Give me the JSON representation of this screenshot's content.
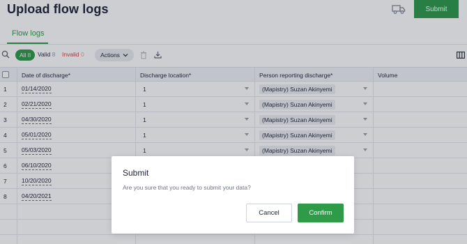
{
  "header": {
    "title": "Upload flow logs",
    "truck_icon": "truck-icon",
    "submit_label": "Submit"
  },
  "tabs": [
    {
      "label": "Flow logs",
      "active": true
    }
  ],
  "toolbar": {
    "search_icon": "search-icon",
    "filters": {
      "all": {
        "label": "All",
        "count": "8"
      },
      "valid": {
        "label": "Valid",
        "count": "8"
      },
      "invalid": {
        "label": "Invalid",
        "count": "0"
      }
    },
    "actions_label": "Actions",
    "icons": [
      "trash-icon",
      "download-icon",
      "columns-icon"
    ]
  },
  "table": {
    "columns": [
      "Date of discharge*",
      "Discharge location*",
      "Person reporting discharge*",
      "Volume"
    ],
    "rows": [
      {
        "num": "1",
        "date": "01/14/2020",
        "location": "1",
        "person": "(Mapistry) Suzan Akinyemi",
        "volume": ""
      },
      {
        "num": "2",
        "date": "02/21/2020",
        "location": "1",
        "person": "(Mapistry) Suzan Akinyemi",
        "volume": ""
      },
      {
        "num": "3",
        "date": "04/30/2020",
        "location": "1",
        "person": "(Mapistry) Suzan Akinyemi",
        "volume": ""
      },
      {
        "num": "4",
        "date": "05/01/2020",
        "location": "1",
        "person": "(Mapistry) Suzan Akinyemi",
        "volume": ""
      },
      {
        "num": "5",
        "date": "05/03/2020",
        "location": "1",
        "person": "(Mapistry) Suzan Akinyemi",
        "volume": ""
      },
      {
        "num": "6",
        "date": "06/10/2020",
        "location": "",
        "person": "",
        "volume": ""
      },
      {
        "num": "7",
        "date": "10/20/2020",
        "location": "",
        "person": "",
        "volume": ""
      },
      {
        "num": "8",
        "date": "04/20/2021",
        "location": "",
        "person": "",
        "volume": ""
      }
    ]
  },
  "modal": {
    "title": "Submit",
    "message": "Are you sure that you ready to submit your data?",
    "cancel_label": "Cancel",
    "confirm_label": "Confirm"
  },
  "colors": {
    "brand_green": "#2f9a48",
    "invalid_red": "#d23a3a",
    "overlay": "rgba(24,30,48,0.22)"
  }
}
